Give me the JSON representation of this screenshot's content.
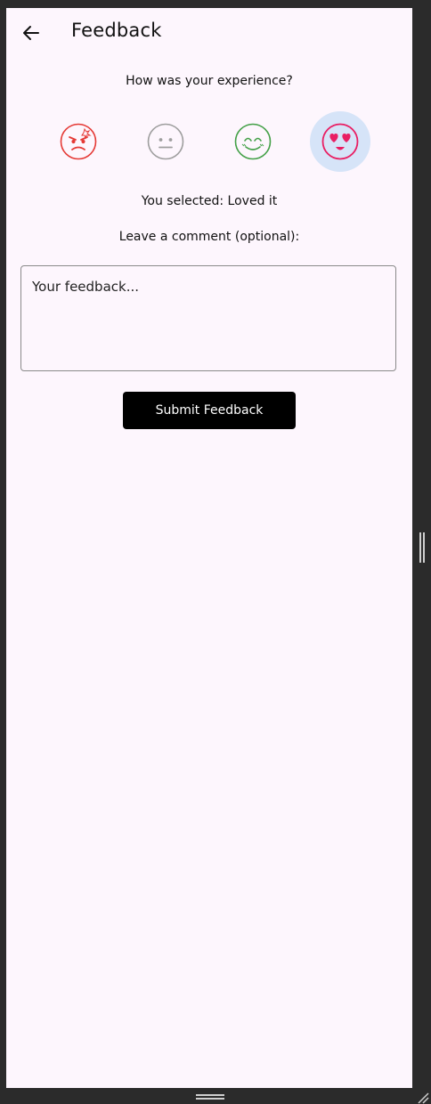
{
  "header": {
    "back_icon": "arrow-left-icon",
    "title": "Feedback"
  },
  "rating": {
    "question": "How was your experience?",
    "options": [
      {
        "icon": "angry-face-icon",
        "color": "#e53935",
        "selected": false
      },
      {
        "icon": "neutral-face-icon",
        "color": "#9e9e9e",
        "selected": false
      },
      {
        "icon": "happy-face-icon",
        "color": "#43a047",
        "selected": false
      },
      {
        "icon": "heart-eyes-face-icon",
        "color": "#e91e63",
        "selected": true
      }
    ],
    "selected_text": "You selected: Loved it",
    "selected_bg": "#d6e4f8"
  },
  "comment": {
    "label": "Leave a comment (optional):",
    "placeholder": "Your feedback...",
    "value": ""
  },
  "submit": {
    "label": "Submit Feedback"
  },
  "colors": {
    "page_bg": "#fdf6fd",
    "window_chrome": "#2b2b2b",
    "button_bg": "#000000",
    "button_text": "#ffffff"
  }
}
